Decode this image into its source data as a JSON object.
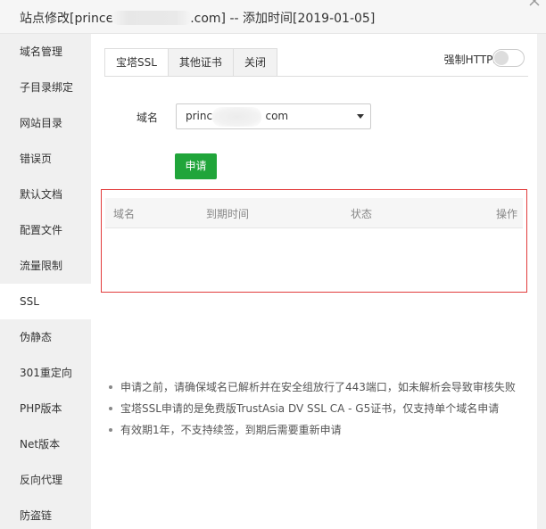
{
  "window": {
    "title_prefix": "站点修改[prince",
    "title_suffix": ".com] -- 添加时间[2019-01-05]"
  },
  "sidebar": {
    "items": [
      {
        "label": "域名管理"
      },
      {
        "label": "子目录绑定"
      },
      {
        "label": "网站目录"
      },
      {
        "label": "错误页"
      },
      {
        "label": "默认文档"
      },
      {
        "label": "配置文件"
      },
      {
        "label": "流量限制"
      },
      {
        "label": "SSL",
        "active": true
      },
      {
        "label": "伪静态"
      },
      {
        "label": "301重定向"
      },
      {
        "label": "PHP版本"
      },
      {
        "label": "Net版本"
      },
      {
        "label": "反向代理"
      },
      {
        "label": "防盗链"
      }
    ]
  },
  "tabs": [
    {
      "label": "宝塔SSL",
      "active": true
    },
    {
      "label": "其他证书"
    },
    {
      "label": "关闭"
    }
  ],
  "force_https": {
    "label": "强制HTTPS",
    "enabled": false
  },
  "form": {
    "domain_label": "域名",
    "domain_value_prefix": "prince",
    "domain_value_suffix": "com",
    "apply_label": "申请"
  },
  "cert_table": {
    "columns": [
      "域名",
      "到期时间",
      "状态",
      "操作"
    ],
    "rows": []
  },
  "notes": [
    "申请之前，请确保域名已解析并在安全组放行了443端口，如未解析会导致审核失败",
    "宝塔SSL申请的是免费版TrustAsia DV SSL CA - G5证书，仅支持单个域名申请",
    "有效期1年，不支持续签，到期后需要重新申请"
  ],
  "colors": {
    "accent_green": "#20a53a",
    "highlight_border": "#e23c3c",
    "sidebar_bg": "#f0f0f0"
  }
}
